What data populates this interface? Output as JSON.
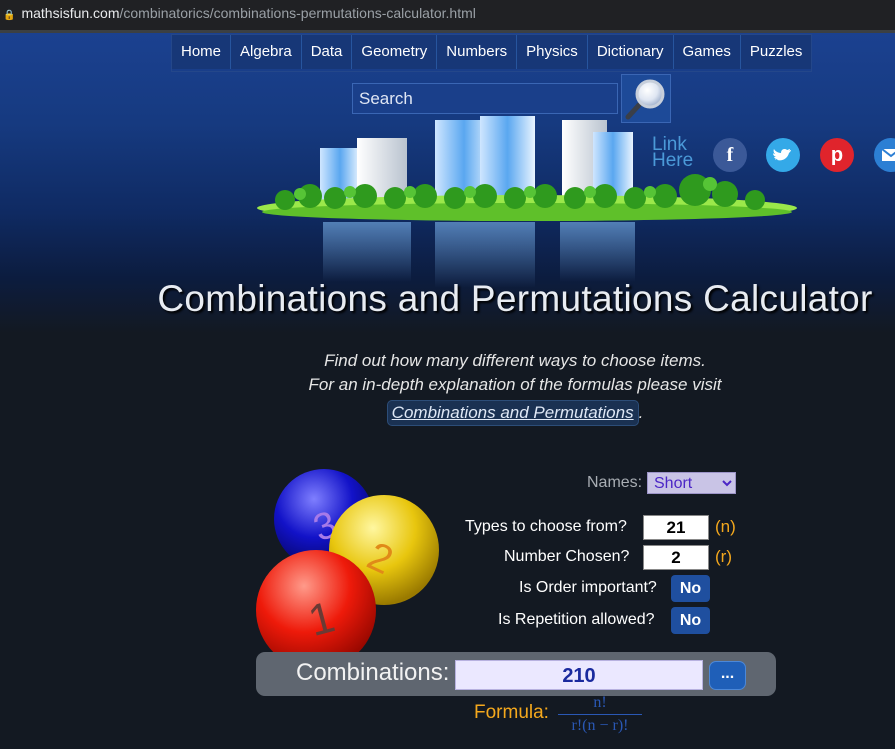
{
  "browser": {
    "url_domain": "mathsisfun.com",
    "url_path": "/combinatorics/combinations-permutations-calculator.html"
  },
  "nav": {
    "items": [
      "Home",
      "Algebra",
      "Data",
      "Geometry",
      "Numbers",
      "Physics",
      "Dictionary",
      "Games",
      "Puzzles"
    ]
  },
  "search": {
    "placeholder": "Search"
  },
  "header": {
    "link_here_line1": "Link",
    "link_here_line2": "Here",
    "social": {
      "facebook": "f",
      "twitter": "t",
      "pinterest": "p",
      "email": "m"
    }
  },
  "title": "Combinations and Permutations Calculator",
  "intro": {
    "line1": "Find out how many different ways to choose items.",
    "line2": "For an in-depth explanation of the formulas please visit",
    "link_text": "Combinations and Permutations",
    "link_suffix": "."
  },
  "balls": [
    {
      "number": "3",
      "color": "#1212c8"
    },
    {
      "number": "2",
      "color": "#e8c60e"
    },
    {
      "number": "1",
      "color": "#ee1a0a"
    }
  ],
  "form": {
    "names_label": "Names:",
    "names_selected": "Short",
    "types_label": "Types to choose from?",
    "types_value": "21",
    "types_var": "(n)",
    "chosen_label": "Number Chosen?",
    "chosen_value": "2",
    "chosen_var": "(r)",
    "order_label": "Is Order important?",
    "order_value": "No",
    "repetition_label": "Is Repetition allowed?",
    "repetition_value": "No"
  },
  "result": {
    "label": "Combinations:",
    "value": "210",
    "more_label": "...",
    "formula_label": "Formula:",
    "formula_numerator": "n!",
    "formula_denominator": "r!(n − r)!"
  },
  "colors": {
    "accent_orange": "#f4a81d",
    "nav_blue": "#173777",
    "toggle_blue": "#1f4f9f",
    "background": "#131922"
  }
}
